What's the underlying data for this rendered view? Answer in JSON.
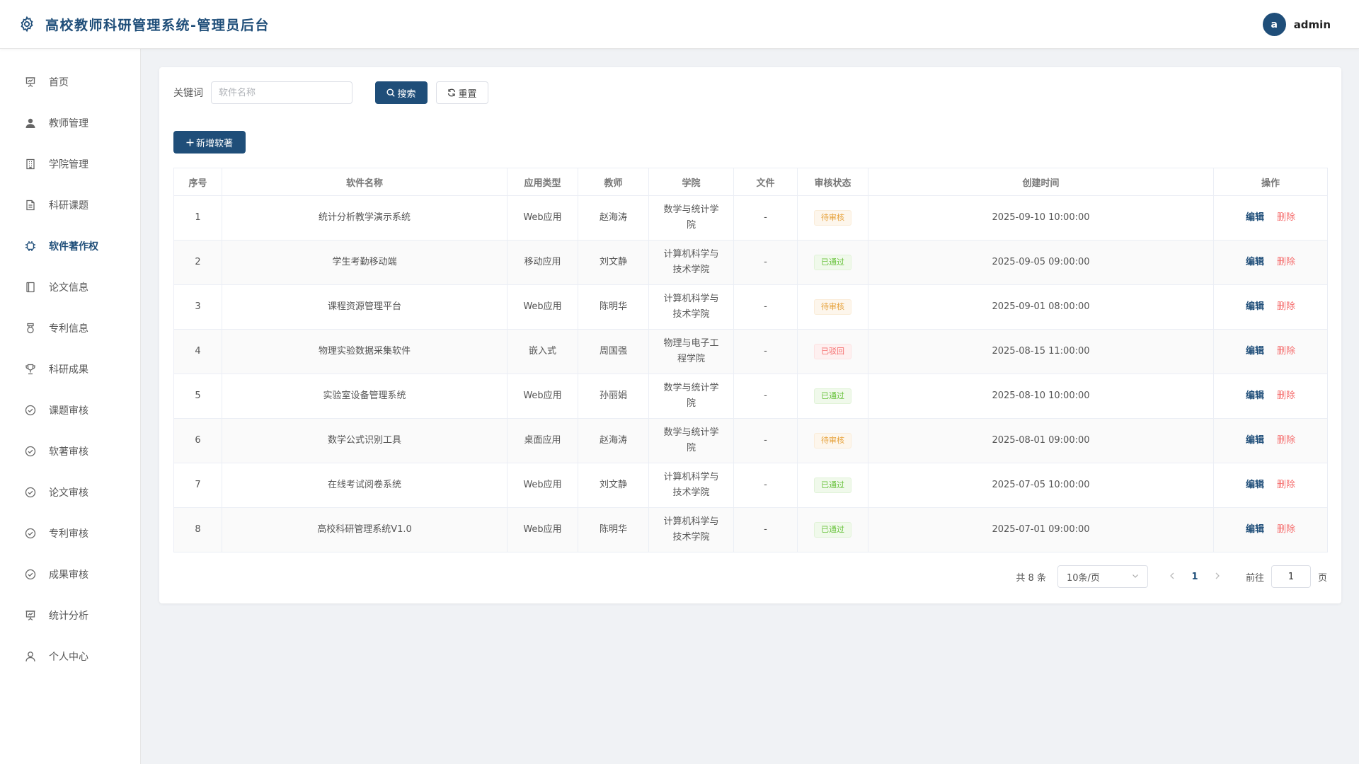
{
  "header": {
    "title": "高校教师科研管理系统-管理员后台",
    "avatar_letter": "a",
    "username": "admin"
  },
  "sidebar": {
    "items": [
      {
        "label": "首页",
        "icon": "presentation-icon",
        "active": false
      },
      {
        "label": "教师管理",
        "icon": "user-filled-icon",
        "active": false
      },
      {
        "label": "学院管理",
        "icon": "building-icon",
        "active": false
      },
      {
        "label": "科研课题",
        "icon": "document-icon",
        "active": false
      },
      {
        "label": "软件著作权",
        "icon": "cpu-icon",
        "active": true
      },
      {
        "label": "论文信息",
        "icon": "notebook-icon",
        "active": false
      },
      {
        "label": "专利信息",
        "icon": "medal-icon",
        "active": false
      },
      {
        "label": "科研成果",
        "icon": "trophy-icon",
        "active": false
      },
      {
        "label": "课题审核",
        "icon": "circle-check-icon",
        "active": false
      },
      {
        "label": "软著审核",
        "icon": "circle-check-icon",
        "active": false
      },
      {
        "label": "论文审核",
        "icon": "circle-check-icon",
        "active": false
      },
      {
        "label": "专利审核",
        "icon": "circle-check-icon",
        "active": false
      },
      {
        "label": "成果审核",
        "icon": "circle-check-icon",
        "active": false
      },
      {
        "label": "统计分析",
        "icon": "presentation-icon",
        "active": false
      },
      {
        "label": "个人中心",
        "icon": "user-icon",
        "active": false
      }
    ]
  },
  "search": {
    "label": "关键词",
    "value": "",
    "placeholder": "软件名称",
    "search_label": "搜索",
    "reset_label": "重置"
  },
  "toolbar": {
    "add_label": "新增软著"
  },
  "table": {
    "columns": [
      "序号",
      "软件名称",
      "应用类型",
      "教师",
      "学院",
      "文件",
      "审核状态",
      "创建时间",
      "操作"
    ],
    "edit_label": "编辑",
    "delete_label": "删除",
    "rows": [
      {
        "no": "1",
        "name": "统计分析教学演示系统",
        "type": "Web应用",
        "teacher": "赵海涛",
        "college": "数学与统计学院",
        "file": "-",
        "status": "待审核",
        "status_kind": "pending",
        "created": "2025-09-10 10:00:00"
      },
      {
        "no": "2",
        "name": "学生考勤移动端",
        "type": "移动应用",
        "teacher": "刘文静",
        "college": "计算机科学与技术学院",
        "file": "-",
        "status": "已通过",
        "status_kind": "pass",
        "created": "2025-09-05 09:00:00"
      },
      {
        "no": "3",
        "name": "课程资源管理平台",
        "type": "Web应用",
        "teacher": "陈明华",
        "college": "计算机科学与技术学院",
        "file": "-",
        "status": "待审核",
        "status_kind": "pending",
        "created": "2025-09-01 08:00:00"
      },
      {
        "no": "4",
        "name": "物理实验数据采集软件",
        "type": "嵌入式",
        "teacher": "周国强",
        "college": "物理与电子工程学院",
        "file": "-",
        "status": "已驳回",
        "status_kind": "reject",
        "created": "2025-08-15 11:00:00"
      },
      {
        "no": "5",
        "name": "实验室设备管理系统",
        "type": "Web应用",
        "teacher": "孙丽娟",
        "college": "数学与统计学院",
        "file": "-",
        "status": "已通过",
        "status_kind": "pass",
        "created": "2025-08-10 10:00:00"
      },
      {
        "no": "6",
        "name": "数学公式识别工具",
        "type": "桌面应用",
        "teacher": "赵海涛",
        "college": "数学与统计学院",
        "file": "-",
        "status": "待审核",
        "status_kind": "pending",
        "created": "2025-08-01 09:00:00"
      },
      {
        "no": "7",
        "name": "在线考试阅卷系统",
        "type": "Web应用",
        "teacher": "刘文静",
        "college": "计算机科学与技术学院",
        "file": "-",
        "status": "已通过",
        "status_kind": "pass",
        "created": "2025-07-05 10:00:00"
      },
      {
        "no": "8",
        "name": "高校科研管理系统V1.0",
        "type": "Web应用",
        "teacher": "陈明华",
        "college": "计算机科学与技术学院",
        "file": "-",
        "status": "已通过",
        "status_kind": "pass",
        "created": "2025-07-01 09:00:00"
      }
    ]
  },
  "pagination": {
    "total_text": "共 8 条",
    "page_size": "10条/页",
    "current_page": "1",
    "goto_label": "前往",
    "goto_value": "1",
    "page_suffix": "页"
  },
  "colors": {
    "primary": "#1f4e79",
    "pending": "#e6a23c",
    "pass": "#67c23a",
    "reject": "#f56c6c"
  }
}
